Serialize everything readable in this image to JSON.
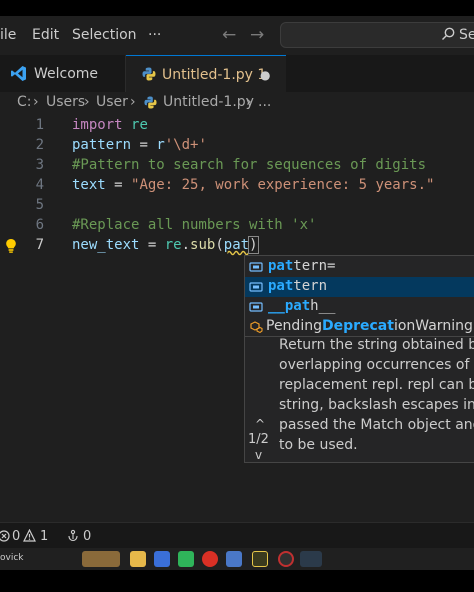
{
  "titlebar": {
    "menu": [
      "ile",
      "Edit",
      "Selection",
      "···"
    ],
    "back_arrow": "←",
    "forward_arrow": "→",
    "search_text": "Se"
  },
  "tabs": [
    {
      "label": "Welcome",
      "icon": "vscode-logo-icon"
    },
    {
      "label": "Untitled-1.py 1",
      "icon": "python-icon",
      "modified": "●"
    }
  ],
  "breadcrumb": [
    "C:",
    "Users",
    "User",
    "Untitled-1.py",
    "..."
  ],
  "editor": {
    "line_numbers": [
      "1",
      "2",
      "3",
      "4",
      "5",
      "6",
      "7"
    ],
    "lines": {
      "l1_kw": "import",
      "l1_mod": "re",
      "l2_var": "pattern",
      "l2_op": " = ",
      "l2_prefix": "r",
      "l2_str": "'\\d+'",
      "l3_cmt": "#Pattern to search for sequences of digits",
      "l4_var": "text",
      "l4_op": " = ",
      "l4_str": "\"Age: 25, work experience: 5 years.\"",
      "l6_cmt": "#Replace all numbers with 'x'",
      "l7_var": "new_text",
      "l7_op": " = ",
      "l7_mod": "re",
      "l7_dot": ".",
      "l7_fn": "sub",
      "l7_paren": "(",
      "l7_arg": "pat",
      "l7_close": ")"
    },
    "lightbulb_icon": "lightbulb-icon"
  },
  "suggest": {
    "items": [
      {
        "match": "pat",
        "rest": "tern="
      },
      {
        "match": "pat",
        "rest": "tern"
      },
      {
        "match": "__pat",
        "rest": "h__"
      },
      {
        "pre": "Pending",
        "match": "Deprecat",
        "rest": "ionWarning"
      }
    ],
    "doc_lines": [
      "Return the string obtained by",
      "overlapping occurrences of th",
      "replacement repl. repl can be",
      "string, backslash escapes in it",
      "passed the Match object and (",
      "to be used."
    ],
    "up_arrow": "^",
    "page": "1/2",
    "down_arrow": "v"
  },
  "statusbar": {
    "errors": "0",
    "warnings": "1",
    "ports": "0"
  },
  "taskbar": {
    "left_text": "ovick"
  },
  "colors": {
    "editor_bg": "#1f1f1f",
    "accent": "#0078d4",
    "keyword": "#c586c0",
    "string": "#ce9178",
    "comment": "#6a9955"
  }
}
